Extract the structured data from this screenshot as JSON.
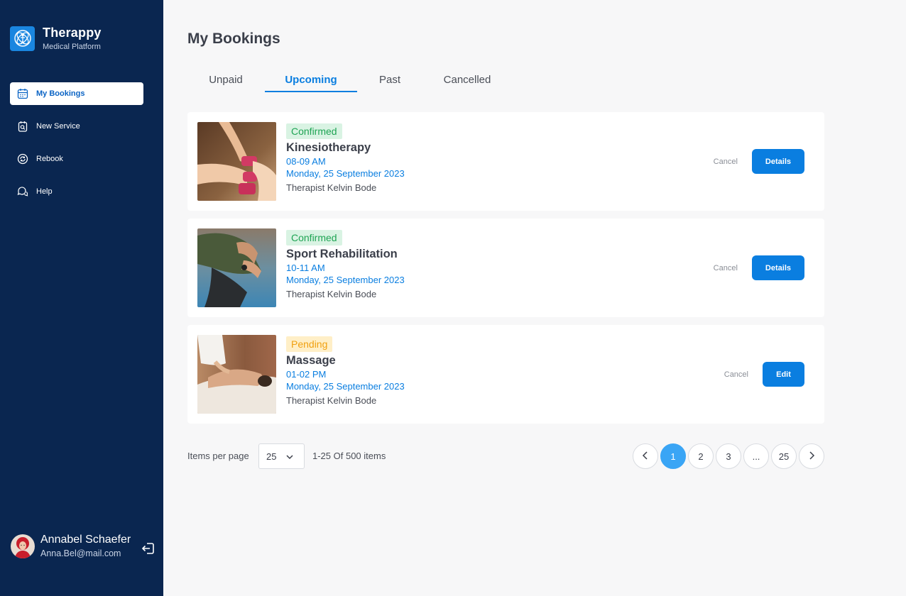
{
  "brand": {
    "name": "Therappy",
    "subtitle": "Medical Platform"
  },
  "sidebar": {
    "items": [
      {
        "label": "My Bookings",
        "icon": "calendar-icon",
        "active": true
      },
      {
        "label": "New Service",
        "icon": "new-service-icon",
        "active": false
      },
      {
        "label": "Rebook",
        "icon": "rebook-icon",
        "active": false
      },
      {
        "label": "Help",
        "icon": "help-chat-icon",
        "active": false
      }
    ]
  },
  "user": {
    "name": "Annabel Schaefer",
    "email": "Anna.Bel@mail.com"
  },
  "main": {
    "title": "My Bookings",
    "tabs": [
      {
        "label": "Unpaid",
        "active": false
      },
      {
        "label": "Upcoming",
        "active": true
      },
      {
        "label": "Past",
        "active": false
      },
      {
        "label": "Cancelled",
        "active": false
      }
    ]
  },
  "bookings": [
    {
      "status": "Confirmed",
      "service": "Kinesiotherapy",
      "time": "08-09 AM",
      "date": "Monday, 25 September 2023",
      "therapist": "Therapist Kelvin Bode",
      "cancel_label": "Cancel",
      "action_label": "Details"
    },
    {
      "status": "Confirmed",
      "service": "Sport Rehabilitation",
      "time": "10-11 AM",
      "date": "Monday, 25 September 2023",
      "therapist": "Therapist Kelvin Bode",
      "cancel_label": "Cancel",
      "action_label": "Details"
    },
    {
      "status": "Pending",
      "service": "Massage",
      "time": "01-02 PM",
      "date": "Monday, 25 September 2023",
      "therapist": "Therapist Kelvin Bode",
      "cancel_label": "Cancel",
      "action_label": "Edit"
    }
  ],
  "pagination": {
    "items_per_page_label": "Items per page",
    "items_per_page": "25",
    "range": "1-25 Of 500 items",
    "pages": [
      "1",
      "2",
      "3",
      "...",
      "25"
    ],
    "current": "1"
  },
  "colors": {
    "sidebar_bg": "#0a2650",
    "accent": "#0a7ee0",
    "confirmed": "#1fa454",
    "pending": "#f0a010",
    "page_active": "#3aa5f5"
  }
}
